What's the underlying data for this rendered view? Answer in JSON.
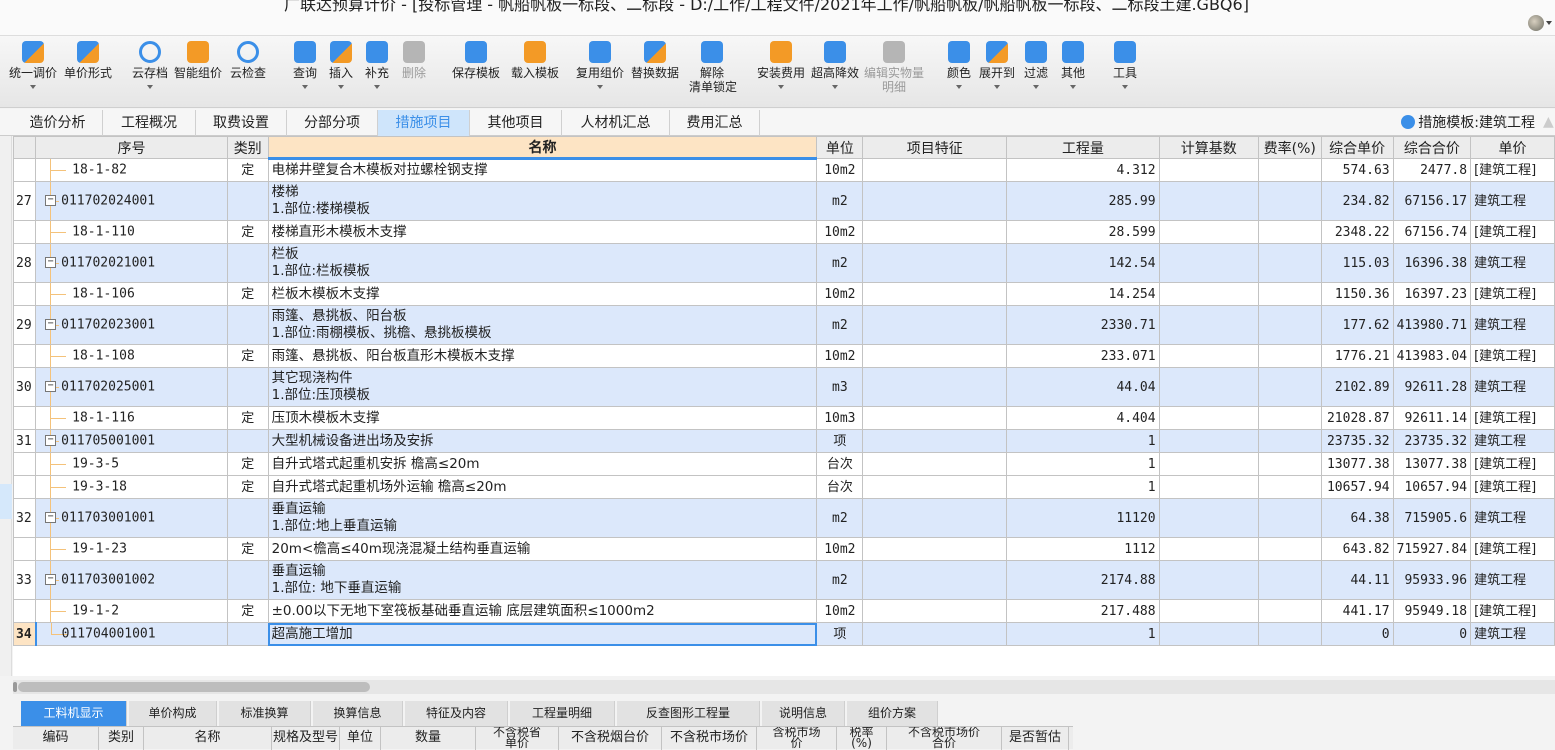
{
  "window": {
    "title": "广联达预算计价 - [投标管理 - 帆船帆板一标段、二标段 - D:/工作/工程文件/2021年工作/帆船帆板/帆船帆板一标段、二标段土建.GBQ6]"
  },
  "toolbar": {
    "buttons": [
      {
        "label": "统一调价",
        "icon": "unify-price-icon",
        "dropdown": true
      },
      {
        "label": "单价形式",
        "icon": "unit-price-form-icon",
        "dropdown": false
      },
      {
        "label": "云存档",
        "icon": "cloud-upload-icon",
        "dropdown": true
      },
      {
        "label": "智能组价",
        "icon": "smart-pricing-icon",
        "dropdown": false
      },
      {
        "label": "云检查",
        "icon": "cloud-check-icon",
        "dropdown": false
      },
      {
        "label": "查询",
        "icon": "query-icon",
        "dropdown": true
      },
      {
        "label": "插入",
        "icon": "insert-icon",
        "dropdown": true
      },
      {
        "label": "补充",
        "icon": "supplement-icon",
        "dropdown": true
      },
      {
        "label": "删除",
        "icon": "delete-icon",
        "dropdown": false,
        "disabled": true
      },
      {
        "label": "保存模板",
        "icon": "save-template-icon",
        "dropdown": false
      },
      {
        "label": "载入模板",
        "icon": "load-template-icon",
        "dropdown": false
      },
      {
        "label": "复用组价",
        "icon": "reuse-pricing-icon",
        "dropdown": true
      },
      {
        "label": "替换数据",
        "icon": "replace-data-icon",
        "dropdown": false
      },
      {
        "label": "解除",
        "label2": "清单锁定",
        "icon": "unlock-icon",
        "dropdown": false
      },
      {
        "label": "安装费用",
        "icon": "install-cost-icon",
        "dropdown": true
      },
      {
        "label": "超高降效",
        "icon": "high-rise-icon",
        "dropdown": true
      },
      {
        "label": "编辑实物量",
        "label2": "明细",
        "icon": "edit-quantity-icon",
        "dropdown": false,
        "disabled": true
      },
      {
        "label": "颜色",
        "icon": "color-icon",
        "dropdown": true
      },
      {
        "label": "展开到",
        "icon": "expand-to-icon",
        "dropdown": true
      },
      {
        "label": "过滤",
        "icon": "filter-icon",
        "dropdown": true
      },
      {
        "label": "其他",
        "icon": "other-icon",
        "dropdown": true
      },
      {
        "label": "工具",
        "icon": "tools-icon",
        "dropdown": true
      }
    ]
  },
  "tabs": [
    {
      "label": "造价分析",
      "active": false
    },
    {
      "label": "工程概况",
      "active": false
    },
    {
      "label": "取费设置",
      "active": false
    },
    {
      "label": "分部分项",
      "active": false
    },
    {
      "label": "措施项目",
      "active": true
    },
    {
      "label": "其他项目",
      "active": false
    },
    {
      "label": "人材机汇总",
      "active": false
    },
    {
      "label": "费用汇总",
      "active": false
    }
  ],
  "template_info": "措施模板:建筑工程",
  "grid": {
    "columns": [
      "",
      "序号",
      "类别",
      "名称",
      "单位",
      "项目特征",
      "工程量",
      "计算基数",
      "费率(%)",
      "综合单价",
      "综合合价",
      "单价"
    ],
    "rows": [
      {
        "no": "",
        "code": "18-1-82",
        "type": "定",
        "name": "电梯井壁复合木模板对拉螺栓钢支撑",
        "unit": "10m2",
        "qty": "4.312",
        "unit_price": "574.63",
        "total": "2477.8",
        "profession": "[建筑工程]",
        "level": "child"
      },
      {
        "no": "27",
        "code": "011702024001",
        "type": "",
        "name": "楼梯\n1.部位:楼梯模板",
        "unit": "m2",
        "qty": "285.99",
        "unit_price": "234.82",
        "total": "67156.17",
        "profession": "建筑工程",
        "level": "parent"
      },
      {
        "no": "",
        "code": "18-1-110",
        "type": "定",
        "name": "楼梯直形木模板木支撑",
        "unit": "10m2",
        "qty": "28.599",
        "unit_price": "2348.22",
        "total": "67156.74",
        "profession": "[建筑工程]",
        "level": "child"
      },
      {
        "no": "28",
        "code": "011702021001",
        "type": "",
        "name": "栏板\n1.部位:栏板模板",
        "unit": "m2",
        "qty": "142.54",
        "unit_price": "115.03",
        "total": "16396.38",
        "profession": "建筑工程",
        "level": "parent"
      },
      {
        "no": "",
        "code": "18-1-106",
        "type": "定",
        "name": "栏板木模板木支撑",
        "unit": "10m2",
        "qty": "14.254",
        "unit_price": "1150.36",
        "total": "16397.23",
        "profession": "[建筑工程]",
        "level": "child"
      },
      {
        "no": "29",
        "code": "011702023001",
        "type": "",
        "name": "雨篷、悬挑板、阳台板\n1.部位:雨棚模板、挑檐、悬挑板模板",
        "unit": "m2",
        "qty": "2330.71",
        "unit_price": "177.62",
        "total": "413980.71",
        "profession": "建筑工程",
        "level": "parent"
      },
      {
        "no": "",
        "code": "18-1-108",
        "type": "定",
        "name": "雨篷、悬挑板、阳台板直形木模板木支撑",
        "unit": "10m2",
        "qty": "233.071",
        "unit_price": "1776.21",
        "total": "413983.04",
        "profession": "[建筑工程]",
        "level": "child"
      },
      {
        "no": "30",
        "code": "011702025001",
        "type": "",
        "name": "其它现浇构件\n1.部位:压顶模板",
        "unit": "m3",
        "qty": "44.04",
        "unit_price": "2102.89",
        "total": "92611.28",
        "profession": "建筑工程",
        "level": "parent"
      },
      {
        "no": "",
        "code": "18-1-116",
        "type": "定",
        "name": "压顶木模板木支撑",
        "unit": "10m3",
        "qty": "4.404",
        "unit_price": "21028.87",
        "total": "92611.14",
        "profession": "[建筑工程]",
        "level": "child"
      },
      {
        "no": "31",
        "code": "011705001001",
        "type": "",
        "name": "大型机械设备进出场及安拆",
        "unit": "项",
        "qty": "1",
        "unit_price": "23735.32",
        "total": "23735.32",
        "profession": "建筑工程",
        "level": "parent"
      },
      {
        "no": "",
        "code": "19-3-5",
        "type": "定",
        "name": "自升式塔式起重机安拆 檐高≤20m",
        "unit": "台次",
        "qty": "1",
        "unit_price": "13077.38",
        "total": "13077.38",
        "profession": "[建筑工程]",
        "level": "child"
      },
      {
        "no": "",
        "code": "19-3-18",
        "type": "定",
        "name": "自升式塔式起重机场外运输 檐高≤20m",
        "unit": "台次",
        "qty": "1",
        "unit_price": "10657.94",
        "total": "10657.94",
        "profession": "[建筑工程]",
        "level": "child"
      },
      {
        "no": "32",
        "code": "011703001001",
        "type": "",
        "name": "垂直运输\n1.部位:地上垂直运输",
        "unit": "m2",
        "qty": "11120",
        "unit_price": "64.38",
        "total": "715905.6",
        "profession": "建筑工程",
        "level": "parent"
      },
      {
        "no": "",
        "code": "19-1-23",
        "type": "定",
        "name": "20m<檐高≤40m现浇混凝土结构垂直运输",
        "unit": "10m2",
        "qty": "1112",
        "unit_price": "643.82",
        "total": "715927.84",
        "profession": "[建筑工程]",
        "level": "child"
      },
      {
        "no": "33",
        "code": "011703001002",
        "type": "",
        "name": "垂直运输\n1.部位: 地下垂直运输",
        "unit": "m2",
        "qty": "2174.88",
        "unit_price": "44.11",
        "total": "95933.96",
        "profession": "建筑工程",
        "level": "parent"
      },
      {
        "no": "",
        "code": "19-1-2",
        "type": "定",
        "name": "±0.00以下无地下室筏板基础垂直运输 底层建筑面积≤1000m2",
        "unit": "10m2",
        "qty": "217.488",
        "unit_price": "441.17",
        "total": "95949.18",
        "profession": "[建筑工程]",
        "level": "child"
      },
      {
        "no": "34",
        "code": "011704001001",
        "type": "",
        "name": "超高施工增加",
        "unit": "项",
        "qty": "1",
        "unit_price": "0",
        "total": "0",
        "profession": "建筑工程",
        "level": "parent",
        "selected": true
      }
    ]
  },
  "bottom_tabs": [
    {
      "label": "工料机显示",
      "active": true
    },
    {
      "label": "单价构成",
      "active": false
    },
    {
      "label": "标准换算",
      "active": false
    },
    {
      "label": "换算信息",
      "active": false
    },
    {
      "label": "特征及内容",
      "active": false
    },
    {
      "label": "工程量明细",
      "active": false
    },
    {
      "label": "反查图形工程量",
      "active": false
    },
    {
      "label": "说明信息",
      "active": false
    },
    {
      "label": "组价方案",
      "active": false
    }
  ],
  "bottom_columns": [
    "编码",
    "类别",
    "名称",
    "规格及型号",
    "单位",
    "数量",
    "不含税省\n单价",
    "不含税烟台价",
    "不含税市场价",
    "含税市场\n价",
    "税率\n(%)",
    "不含税市场价\n合价",
    "是否暂估"
  ]
}
